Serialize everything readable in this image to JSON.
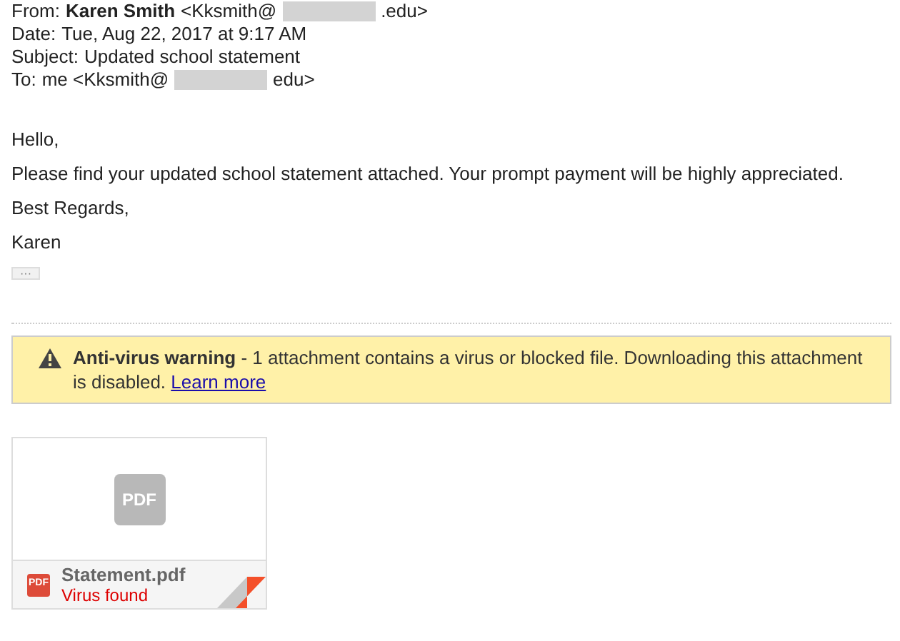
{
  "headers": [
    {
      "label": "From:",
      "parts": [
        {
          "kind": "bold",
          "text": "Karen Smith"
        },
        {
          "kind": "text",
          "text": "<Kksmith@"
        },
        {
          "kind": "redacted"
        },
        {
          "kind": "text",
          "text": ".edu>"
        }
      ]
    },
    {
      "label": "Date:",
      "parts": [
        {
          "kind": "text",
          "text": "Tue, Aug 22, 2017 at 9:17 AM"
        }
      ]
    },
    {
      "label": "Subject:",
      "parts": [
        {
          "kind": "text",
          "text": "Updated school statement"
        }
      ]
    },
    {
      "label": "To:",
      "parts": [
        {
          "kind": "text",
          "text": "me <Kksmith@"
        },
        {
          "kind": "redacted"
        },
        {
          "kind": "text",
          "text": "edu>"
        }
      ]
    }
  ],
  "body": [
    "Hello,",
    "Please find your updated school statement attached. Your prompt payment will be highly appreciated.",
    "Best Regards,",
    "Karen"
  ],
  "more_button": "···",
  "warning": {
    "title": "Anti-virus warning",
    "text": " - 1 attachment contains a virus or blocked file. Downloading this attachment is disabled. ",
    "link": "Learn more"
  },
  "attachment": {
    "preview_label": "PDF",
    "type_label": "PDF",
    "name": "Statement.pdf",
    "status": "Virus found"
  }
}
